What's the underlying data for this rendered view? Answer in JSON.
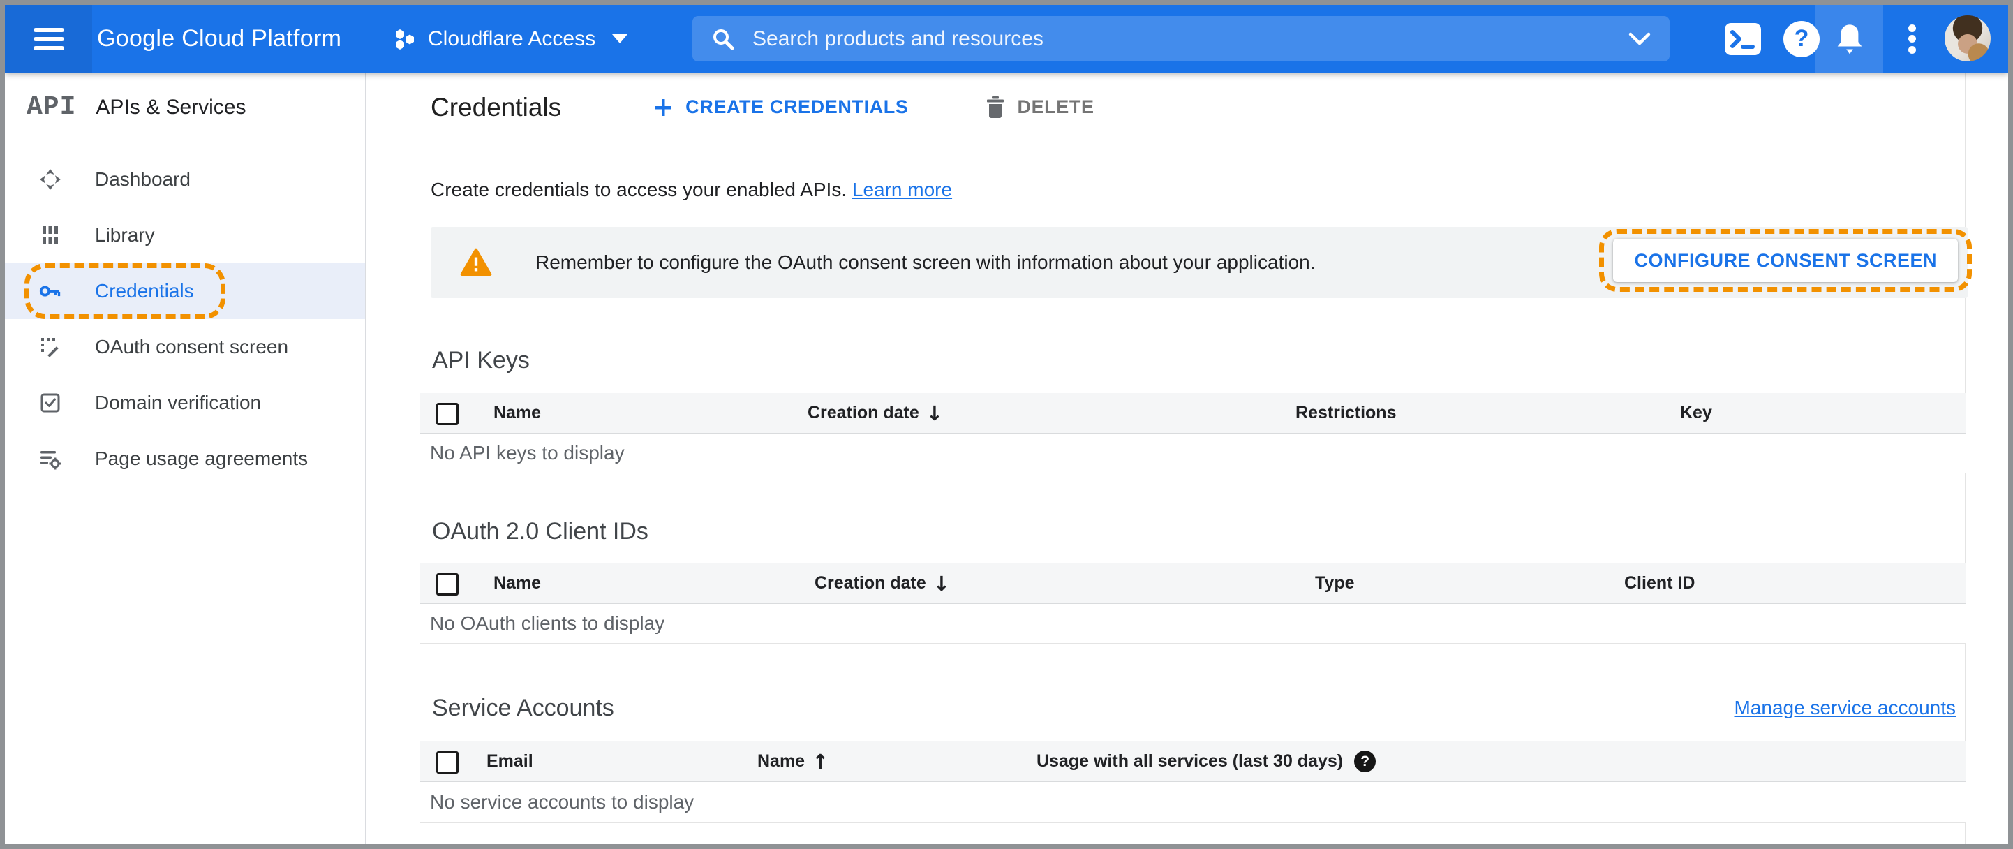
{
  "topbar": {
    "product": "Google Cloud Platform",
    "project_name": "Cloudflare Access",
    "search_placeholder": "Search products and resources"
  },
  "sidebar": {
    "logo": "API",
    "title": "APIs & Services",
    "items": [
      {
        "label": "Dashboard"
      },
      {
        "label": "Library"
      },
      {
        "label": "Credentials"
      },
      {
        "label": "OAuth consent screen"
      },
      {
        "label": "Domain verification"
      },
      {
        "label": "Page usage agreements"
      }
    ]
  },
  "main": {
    "title": "Credentials",
    "create_button": "CREATE CREDENTIALS",
    "delete_button": "DELETE",
    "description": "Create credentials to access your enabled APIs.",
    "learn_more": "Learn more",
    "banner": {
      "message": "Remember to configure the OAuth consent screen with information about your application.",
      "action": "CONFIGURE CONSENT SCREEN"
    },
    "api_keys": {
      "title": "API Keys",
      "columns": [
        "Name",
        "Creation date",
        "Restrictions",
        "Key"
      ],
      "sorted_column": "Creation date",
      "sort_direction": "desc",
      "empty": "No API keys to display"
    },
    "oauth_clients": {
      "title": "OAuth 2.0 Client IDs",
      "columns": [
        "Name",
        "Creation date",
        "Type",
        "Client ID"
      ],
      "sorted_column": "Creation date",
      "sort_direction": "desc",
      "empty": "No OAuth clients to display"
    },
    "service_accounts": {
      "title": "Service Accounts",
      "manage_link": "Manage service accounts",
      "columns": [
        "Email",
        "Name",
        "Usage with all services (last 30 days)"
      ],
      "sorted_column": "Name",
      "sort_direction": "asc",
      "empty": "No service accounts to display"
    }
  },
  "icons": {
    "sort_desc_glyph": "↓",
    "sort_asc_glyph": "↑",
    "help_glyph": "?"
  },
  "colors": {
    "topbar_blue": "#1a73e8",
    "link_blue": "#1a73e8",
    "highlight_orange": "#f29100",
    "banner_gray": "#f1f3f4",
    "selected_item_bg": "#e9eef9"
  }
}
